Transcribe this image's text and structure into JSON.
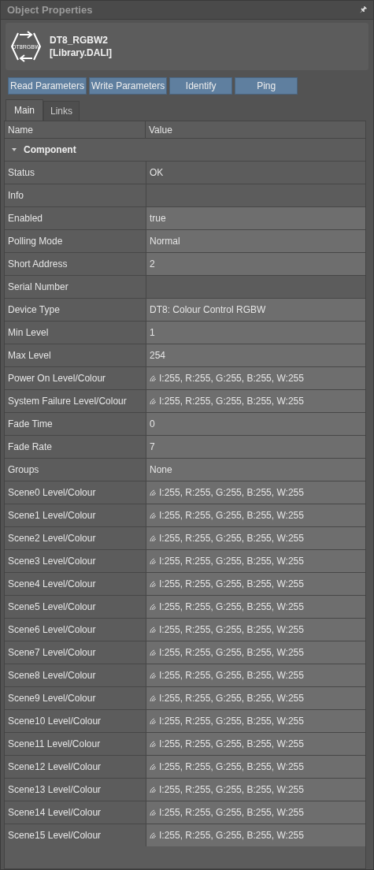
{
  "panel": {
    "title": "Object Properties",
    "pin": "🖈"
  },
  "object": {
    "name": "DT8_RGBW2",
    "library": "[Library.DALI]",
    "icon_label": "DT8RGBW"
  },
  "buttons": [
    "Read Parameters",
    "Write Parameters",
    "Identify",
    "Ping"
  ],
  "tabs": [
    {
      "label": "Main",
      "selected": true
    },
    {
      "label": "Links",
      "selected": false
    }
  ],
  "table": {
    "columns": [
      "Name",
      "Value"
    ],
    "group": {
      "label": "Component",
      "expanded": true
    },
    "rows": [
      {
        "name": "Status",
        "value": "OK",
        "editable": false,
        "kind": "text"
      },
      {
        "name": "Info",
        "editable": false,
        "kind": "text"
      },
      {
        "name": "Enabled",
        "value": "true",
        "editable": true,
        "kind": "text"
      },
      {
        "name": "Polling Mode",
        "value": "Normal",
        "editable": true,
        "kind": "text"
      },
      {
        "name": "Short Address",
        "value": "2",
        "editable": true,
        "kind": "text"
      },
      {
        "name": "Serial Number",
        "editable": false,
        "kind": "text"
      },
      {
        "name": "Device Type",
        "value": "DT8: Colour Control RGBW",
        "editable": true,
        "kind": "text"
      },
      {
        "name": "Min Level",
        "value": "1",
        "editable": true,
        "kind": "text"
      },
      {
        "name": "Max Level",
        "value": "254",
        "editable": true,
        "kind": "text"
      },
      {
        "name": "Power On Level/Colour",
        "value": "I:255, R:255, G:255, B:255, W:255",
        "editable": true,
        "kind": "colour"
      },
      {
        "name": "System Failure Level/Colour",
        "value": "I:255, R:255, G:255, B:255, W:255",
        "editable": true,
        "kind": "colour"
      },
      {
        "name": "Fade Time",
        "value": "0",
        "editable": true,
        "kind": "text"
      },
      {
        "name": "Fade Rate",
        "value": "7",
        "editable": true,
        "kind": "text"
      },
      {
        "name": "Groups",
        "value": "None",
        "editable": true,
        "kind": "text"
      },
      {
        "name": "Scene0 Level/Colour",
        "value": "I:255, R:255, G:255, B:255, W:255",
        "editable": true,
        "kind": "colour"
      },
      {
        "name": "Scene1 Level/Colour",
        "value": "I:255, R:255, G:255, B:255, W:255",
        "editable": true,
        "kind": "colour"
      },
      {
        "name": "Scene2 Level/Colour",
        "value": "I:255, R:255, G:255, B:255, W:255",
        "editable": true,
        "kind": "colour"
      },
      {
        "name": "Scene3 Level/Colour",
        "value": "I:255, R:255, G:255, B:255, W:255",
        "editable": true,
        "kind": "colour"
      },
      {
        "name": "Scene4 Level/Colour",
        "value": "I:255, R:255, G:255, B:255, W:255",
        "editable": true,
        "kind": "colour"
      },
      {
        "name": "Scene5 Level/Colour",
        "value": "I:255, R:255, G:255, B:255, W:255",
        "editable": true,
        "kind": "colour"
      },
      {
        "name": "Scene6 Level/Colour",
        "value": "I:255, R:255, G:255, B:255, W:255",
        "editable": true,
        "kind": "colour"
      },
      {
        "name": "Scene7 Level/Colour",
        "value": "I:255, R:255, G:255, B:255, W:255",
        "editable": true,
        "kind": "colour"
      },
      {
        "name": "Scene8 Level/Colour",
        "value": "I:255, R:255, G:255, B:255, W:255",
        "editable": true,
        "kind": "colour"
      },
      {
        "name": "Scene9 Level/Colour",
        "value": "I:255, R:255, G:255, B:255, W:255",
        "editable": true,
        "kind": "colour"
      },
      {
        "name": "Scene10 Level/Colour",
        "value": "I:255, R:255, G:255, B:255, W:255",
        "editable": true,
        "kind": "colour"
      },
      {
        "name": "Scene11 Level/Colour",
        "value": "I:255, R:255, G:255, B:255, W:255",
        "editable": true,
        "kind": "colour"
      },
      {
        "name": "Scene12 Level/Colour",
        "value": "I:255, R:255, G:255, B:255, W:255",
        "editable": true,
        "kind": "colour"
      },
      {
        "name": "Scene13 Level/Colour",
        "value": "I:255, R:255, G:255, B:255, W:255",
        "editable": true,
        "kind": "colour"
      },
      {
        "name": "Scene14 Level/Colour",
        "value": "I:255, R:255, G:255, B:255, W:255",
        "editable": true,
        "kind": "colour"
      },
      {
        "name": "Scene15 Level/Colour",
        "value": "I:255, R:255, G:255, B:255, W:255",
        "editable": true,
        "kind": "colour"
      }
    ]
  }
}
